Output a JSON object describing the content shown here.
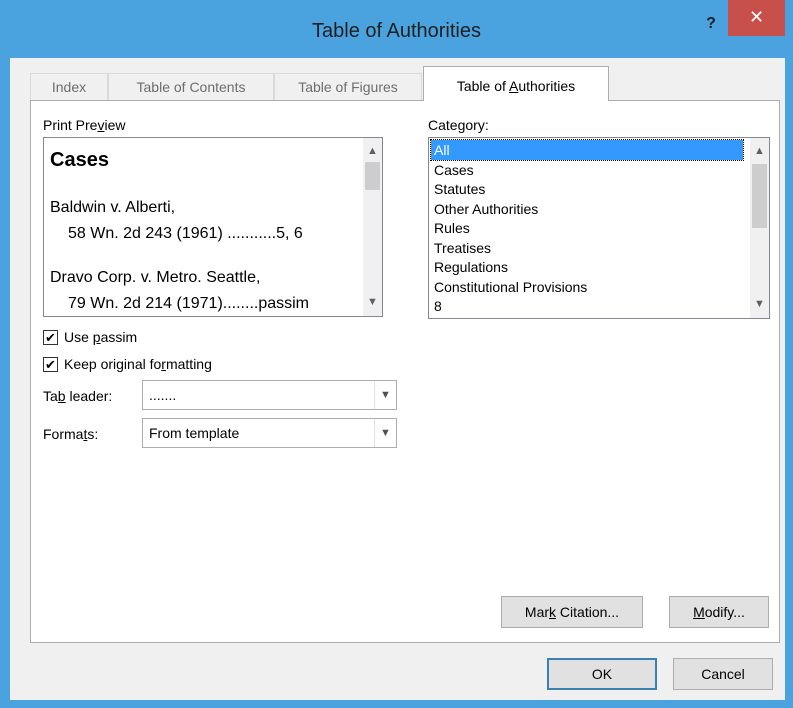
{
  "window": {
    "title": "Table of Authorities",
    "help_label": "?",
    "close_label": "✕"
  },
  "tabs": [
    {
      "label": "Index"
    },
    {
      "label": "Table of Contents"
    },
    {
      "label": "Table of Figures"
    },
    {
      "label_pre": "Table of ",
      "label_ul": "A",
      "label_post": "uthorities"
    }
  ],
  "print_preview": {
    "label_pre": "Print Pre",
    "label_ul": "v",
    "label_post": "iew",
    "heading": "Cases",
    "lines": [
      "Baldwin v. Alberti,",
      "58 Wn. 2d 243 (1961) ...........5, 6",
      "Dravo Corp. v. Metro. Seattle,",
      "79 Wn. 2d 214 (1971)........passim"
    ]
  },
  "category": {
    "label_pre": "Cate",
    "label_ul": "g",
    "label_post": "ory:",
    "items": [
      "All",
      "Cases",
      "Statutes",
      "Other Authorities",
      "Rules",
      "Treatises",
      "Regulations",
      "Constitutional Provisions",
      "8"
    ],
    "selected": "All"
  },
  "options": {
    "use_passim": {
      "label_pre": "Use ",
      "label_ul": "p",
      "label_post": "assim",
      "checked": true
    },
    "keep_formatting": {
      "label_pre": "Keep original fo",
      "label_ul": "r",
      "label_post": "matting",
      "checked": true
    },
    "check_mark": "✔"
  },
  "tab_leader": {
    "label_pre": "Ta",
    "label_ul": "b",
    "label_post": " leader:",
    "value": "......."
  },
  "formats": {
    "label_pre": "Forma",
    "label_ul": "t",
    "label_post": "s:",
    "value": "From template"
  },
  "buttons": {
    "mark_citation": {
      "pre": "Mar",
      "ul": "k",
      "post": " Citation..."
    },
    "modify": {
      "pre": "",
      "ul": "M",
      "post": "odify..."
    },
    "ok": "OK",
    "cancel": "Cancel"
  },
  "icons": {
    "scroll_up": "▲",
    "scroll_down": "▼",
    "dropdown": "▼"
  },
  "colors": {
    "title_bar": "#4aa3df",
    "close_button": "#c7504b",
    "selection": "#3399ff"
  }
}
